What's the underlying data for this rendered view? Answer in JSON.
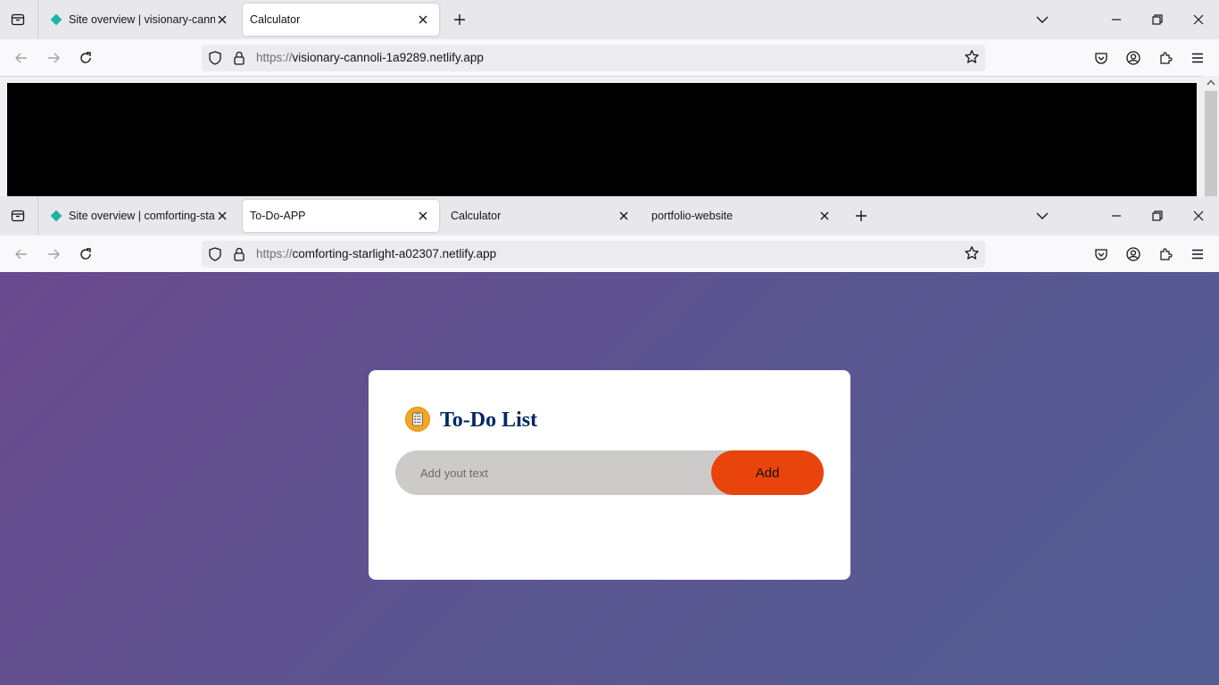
{
  "window1": {
    "tabs": [
      {
        "title": "Site overview | visionary-cannoli",
        "favicon": "netlify-diamond-icon",
        "active": false
      },
      {
        "title": "Calculator",
        "favicon": "",
        "active": true
      }
    ],
    "url_protocol": "https://",
    "url_host": "visionary-cannoli-1a9289.netlify.app"
  },
  "window2": {
    "tabs": [
      {
        "title": "Site overview | comforting-starlight",
        "favicon": "netlify-diamond-icon",
        "active": false
      },
      {
        "title": "To-Do-APP",
        "favicon": "",
        "active": true
      },
      {
        "title": "Calculator",
        "favicon": "",
        "active": false
      },
      {
        "title": "portfolio-website",
        "favicon": "",
        "active": false
      }
    ],
    "url_protocol": "https://",
    "url_host": "comforting-starlight-a02307.netlify.app"
  },
  "todo": {
    "heading": "To-Do List",
    "input_placeholder": "Add yout text",
    "add_label": "Add"
  },
  "colors": {
    "netlify": "#1fb2a6",
    "add_button": "#e8440c",
    "heading": "#002765",
    "input_bg": "#cdcbc9"
  }
}
